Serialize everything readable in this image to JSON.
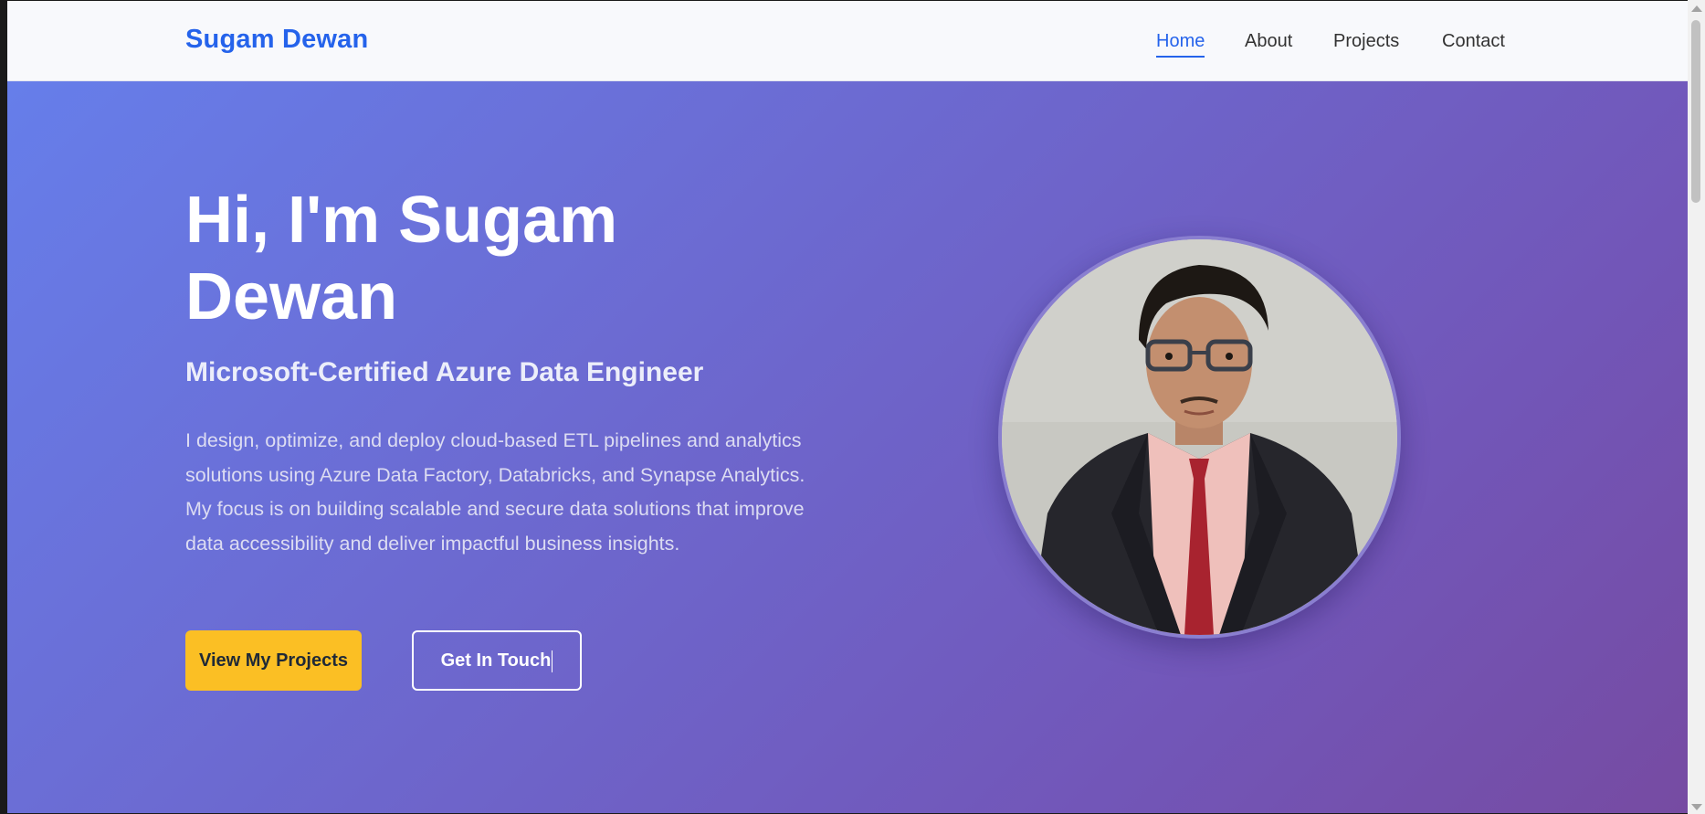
{
  "navbar": {
    "logo": "Sugam Dewan",
    "links": [
      {
        "label": "Home",
        "active": true
      },
      {
        "label": "About",
        "active": false
      },
      {
        "label": "Projects",
        "active": false
      },
      {
        "label": "Contact",
        "active": false
      }
    ]
  },
  "hero": {
    "title_line1": "Hi, I'm Sugam",
    "title_line2": "Dewan",
    "subtitle": "Microsoft-Certified Azure Data Engineer",
    "description": "I design, optimize, and deploy cloud-based ETL pipelines and analytics solutions using Azure Data Factory, Databricks, and Synapse Analytics. My focus is on building scalable and secure data solutions that improve data accessibility and deliver impactful business insights.",
    "primary_button": "View My Projects",
    "secondary_button": "Get In Touch",
    "portrait_icon": "profile-photo"
  },
  "colors": {
    "accent": "#2563eb",
    "button_primary": "#fbbf24",
    "hero_gradient_start": "#667eea",
    "hero_gradient_end": "#764ba2"
  }
}
